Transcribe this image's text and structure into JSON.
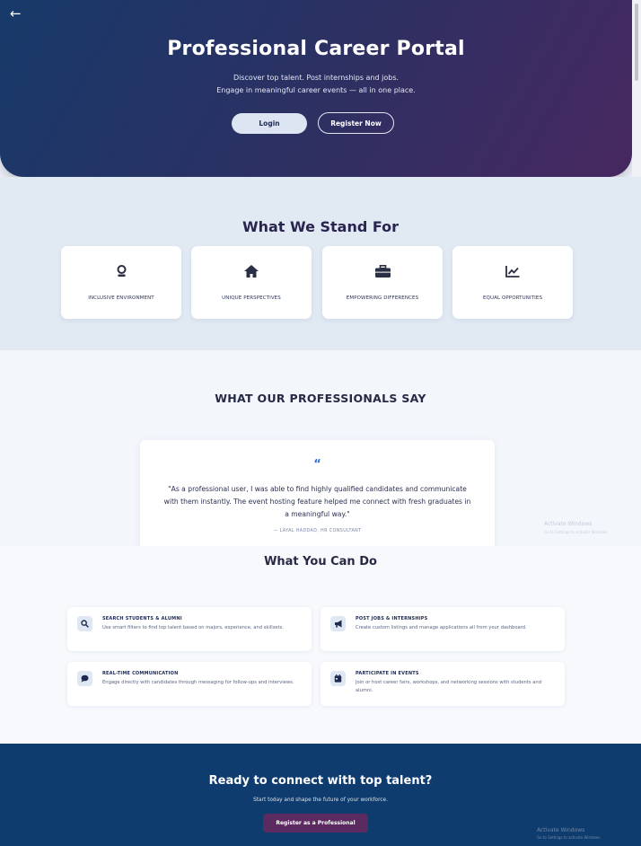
{
  "hero": {
    "back_icon": "arrow-left-icon",
    "title": "Professional Career Portal",
    "subtitle_line1": "Discover top talent. Post internships and jobs.",
    "subtitle_line2": "Engage in meaningful career events — all in one place.",
    "login_label": "Login",
    "register_label": "Register Now",
    "gradient_start": "#173a6a",
    "gradient_end": "#472860"
  },
  "values": {
    "heading": "What We Stand For",
    "cards": [
      {
        "label": "INCLUSIVE ENVIRONMENT",
        "icon": "award-icon"
      },
      {
        "label": "UNIQUE PERSPECTIVES",
        "icon": "home-icon"
      },
      {
        "label": "EMPOWERING DIFFERENCES",
        "icon": "briefcase-icon"
      },
      {
        "label": "EQUAL OPPORTUNITIES",
        "icon": "chart-line-icon"
      }
    ]
  },
  "testimonials": {
    "heading": "WHAT OUR PROFESSIONALS SAY",
    "quote_icon": "quote-icon",
    "quote_line1": "\"As a professional user, I was able to find highly qualified candidates and communicate",
    "quote_line2": "with them instantly. The event hosting feature helped me connect with fresh graduates in",
    "quote_line3": "a meaningful way.\"",
    "author": "— LAYAL HADDAD, HR CONSULTANT"
  },
  "features": {
    "heading": "What You Can Do",
    "items": [
      {
        "title": "SEARCH STUDENTS & ALUMNI",
        "desc": "Use smart filters to find top talent based on majors, experience, and skillsets.",
        "icon": "search-icon"
      },
      {
        "title": "POST JOBS & INTERNSHIPS",
        "desc": "Create custom listings and manage applications all from your dashboard.",
        "icon": "megaphone-icon"
      },
      {
        "title": "REAL-TIME COMMUNICATION",
        "desc": "Engage directly with candidates through messaging for follow-ups and interviews.",
        "icon": "chat-icon"
      },
      {
        "title": "PARTICIPATE IN EVENTS",
        "desc": "Join or host career fairs, workshops, and networking sessions with students and alumni.",
        "icon": "calendar-icon"
      }
    ]
  },
  "cta": {
    "heading": "Ready to connect with top talent?",
    "subtext": "Start today and shape the future of your workforce.",
    "button_label": "Register as a Professional",
    "background": "#0f3c6e",
    "button_color": "#5a2a60"
  },
  "watermark": {
    "title": "Activate Windows",
    "subtitle": "Go to Settings to activate Windows."
  }
}
